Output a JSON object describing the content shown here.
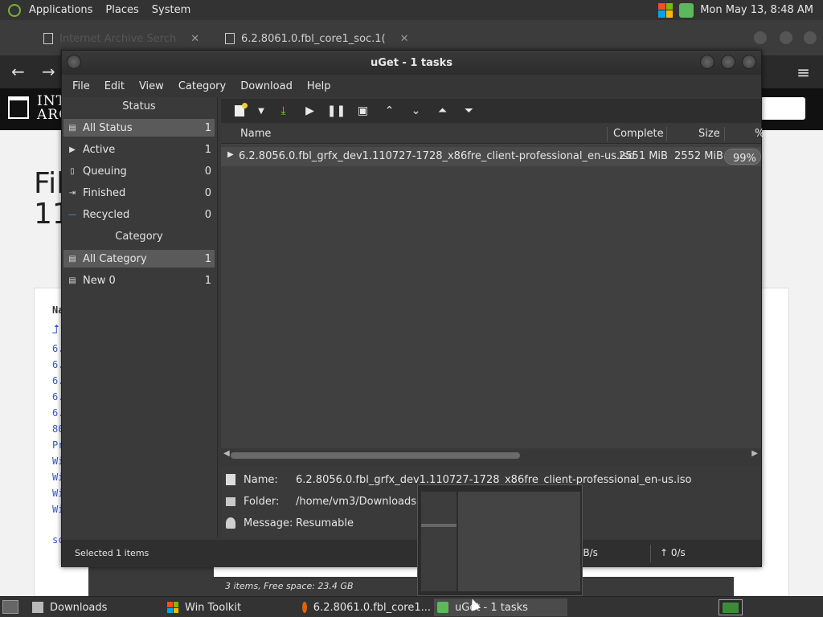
{
  "top_panel": {
    "menus": [
      "Applications",
      "Places",
      "System"
    ],
    "clock": "Mon May 13,  8:48 AM"
  },
  "browser": {
    "tabs": [
      {
        "title": "Internet Archive Serch"
      },
      {
        "title": "6.2.8061.0.fbl_core1_soc.1("
      }
    ],
    "ia_logo_text_line1": "INT",
    "ia_logo_text_line2": "ARC",
    "page_heading_line1": "Fil",
    "page_heading_line2": "11",
    "card_header": "Na",
    "file_lines": [
      "6.",
      "6.",
      "6.",
      "6.",
      "6.",
      "80",
      "Pr",
      "Wi",
      "Wi",
      "Wi",
      "Wi",
      "sc"
    ]
  },
  "uget": {
    "title": "uGet - 1 tasks",
    "menu": [
      "File",
      "Edit",
      "View",
      "Category",
      "Download",
      "Help"
    ],
    "status_section": "Status",
    "status_items": [
      {
        "label": "All Status",
        "count": "1",
        "icon": "stack-icon",
        "selected": true
      },
      {
        "label": "Active",
        "count": "1",
        "icon": "play-icon",
        "selected": false
      },
      {
        "label": "Queuing",
        "count": "0",
        "icon": "document-icon",
        "selected": false
      },
      {
        "label": "Finished",
        "count": "0",
        "icon": "finish-icon",
        "selected": false
      },
      {
        "label": "Recycled",
        "count": "0",
        "icon": "minus-icon",
        "selected": false
      }
    ],
    "category_section": "Category",
    "category_items": [
      {
        "label": "All Category",
        "count": "1",
        "selected": true
      },
      {
        "label": "New 0",
        "count": "1",
        "selected": false
      }
    ],
    "toolbar_icons": [
      "new-download-icon",
      "dropdown-arrow-icon",
      "download-icon",
      "start-icon",
      "pause-icon",
      "properties-icon",
      "move-up-icon",
      "move-down-icon",
      "move-top-icon",
      "move-bottom-icon"
    ],
    "columns": {
      "name": "Name",
      "complete": "Complete",
      "size": "Size",
      "percent": "%"
    },
    "task": {
      "name": "6.2.8056.0.fbl_grfx_dev1.110727-1728_x86fre_client-professional_en-us.iso",
      "complete": "2551 MiB",
      "size": "2552 MiB",
      "percent": "99%",
      "progress": 0.99
    },
    "details": {
      "name_label": "Name:",
      "name_value": "6.2.8056.0.fbl_grfx_dev1.110727-1728_x86fre_client-professional_en-us.iso",
      "folder_label": "Folder:",
      "folder_value": "/home/vm3/Downloads",
      "message_label": "Message:",
      "message_value": "Resumable"
    },
    "statusbar": {
      "selected": "Selected 1 items",
      "down_speed": "iB/s",
      "up_speed": "↑  0/s"
    }
  },
  "files_window": {
    "footer": "3 items, Free space: 23.4 GB"
  },
  "taskbar": {
    "tasks": [
      {
        "label": "Downloads",
        "icon": "folder-icon",
        "active": false
      },
      {
        "label": "Win Toolkit",
        "icon": "windows-icon",
        "active": false
      },
      {
        "label": "6.2.8061.0.fbl_core1...",
        "icon": "firefox-icon",
        "active": false
      },
      {
        "label": "uGet - 1 tasks",
        "icon": "uget-icon",
        "active": true
      }
    ]
  },
  "colors": {
    "accent_green": "#7ab036",
    "uget_dark_bg": "#383838",
    "selection": "#5a5a5a",
    "link_blue": "#3955c8"
  }
}
